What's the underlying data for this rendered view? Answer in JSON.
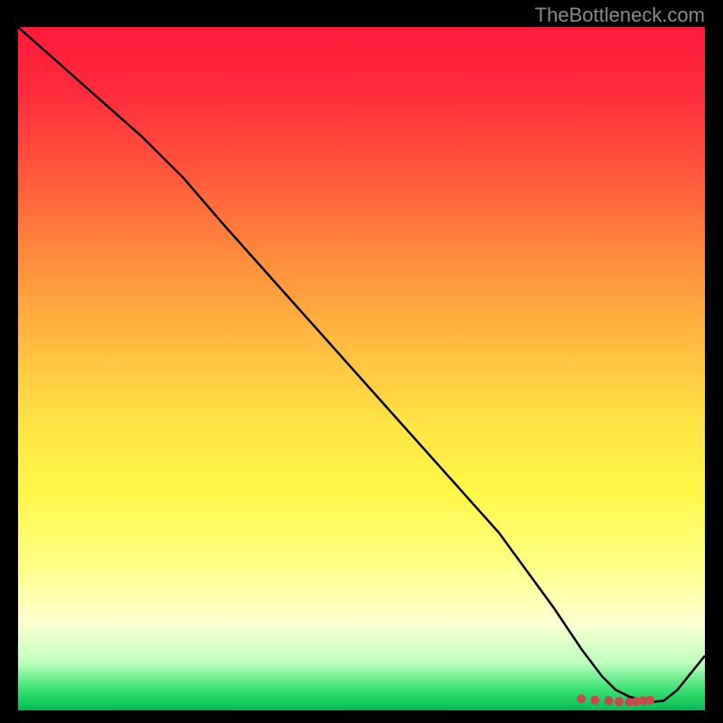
{
  "watermark": "TheBottleneck.com",
  "chart_data": {
    "type": "line",
    "title": "",
    "xlabel": "",
    "ylabel": "",
    "xlim": [
      0,
      100
    ],
    "ylim": [
      0,
      100
    ],
    "grid": false,
    "x": [
      0,
      9,
      18,
      24,
      30,
      38,
      46,
      54,
      62,
      70,
      78,
      82,
      85,
      87,
      89,
      91,
      92,
      94,
      96,
      100
    ],
    "values": [
      100,
      92,
      84,
      78,
      71,
      62,
      53,
      44,
      35,
      26,
      15,
      9,
      5,
      3,
      2,
      1.5,
      1.2,
      1.4,
      3,
      8
    ],
    "markers": {
      "x": [
        82,
        84,
        86,
        87.5,
        89,
        90,
        91,
        92
      ],
      "y": [
        1.7,
        1.5,
        1.4,
        1.3,
        1.2,
        1.3,
        1.4,
        1.5
      ]
    }
  }
}
